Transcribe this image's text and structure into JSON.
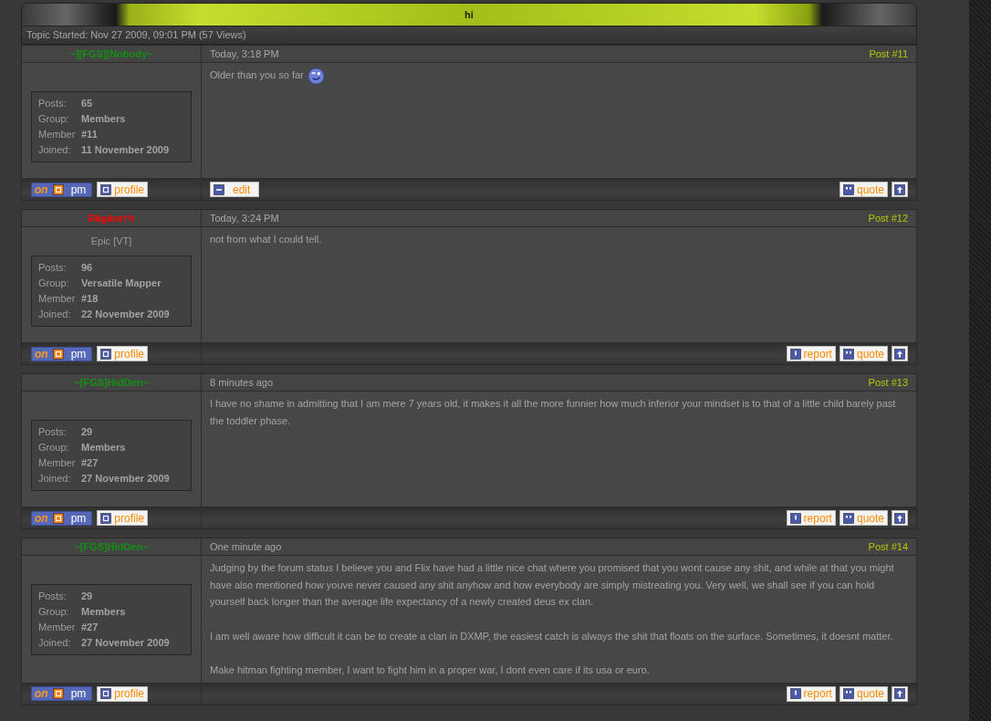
{
  "topic": {
    "title": "hi",
    "started": "Topic Started: Nov 27 2009, 09:01 PM (57 Views)"
  },
  "posts": [
    {
      "author": "~][FGS][Nobody~",
      "color": "#139013",
      "stats": [
        {
          "label": "Posts:",
          "value": "65"
        },
        {
          "label": "Group:",
          "value": "Members"
        },
        {
          "label": "Member",
          "value": "#11"
        },
        {
          "label": "Joined:",
          "value": "11 November 2009"
        }
      ],
      "time": "Today, 3:18 PM",
      "number": "Post #11",
      "paragraphs": [
        "Older than you so far"
      ],
      "smiley": true,
      "user_buttons": [
        {
          "kind": "pm",
          "status": "on",
          "label": "pm"
        },
        {
          "kind": "profile",
          "label": "profile"
        }
      ],
      "post_buttons_left": [
        {
          "kind": "edit",
          "label": "edit"
        }
      ],
      "post_buttons": [
        {
          "kind": "quote",
          "label": "quote"
        },
        {
          "kind": "top"
        }
      ]
    },
    {
      "author": "Ðägärø†h",
      "color": "#ff0000",
      "member_title": "Epic [VT]",
      "stats": [
        {
          "label": "Posts:",
          "value": "96"
        },
        {
          "label": "Group:",
          "value": "Versatile Mapper"
        },
        {
          "label": "Member",
          "value": "#18"
        },
        {
          "label": "Joined:",
          "value": "22 November 2009"
        }
      ],
      "time": "Today, 3:24 PM",
      "number": "Post #12",
      "paragraphs": [
        "not from what I could tell."
      ],
      "smiley": false,
      "user_buttons": [
        {
          "kind": "pm",
          "status": "on",
          "label": "pm"
        },
        {
          "kind": "profile",
          "label": "profile"
        }
      ],
      "post_buttons": [
        {
          "kind": "report",
          "label": "report"
        },
        {
          "kind": "quote",
          "label": "quote"
        },
        {
          "kind": "top"
        }
      ]
    },
    {
      "author": "~[FGS]HidDen~",
      "color": "#139013",
      "stats": [
        {
          "label": "Posts:",
          "value": "29"
        },
        {
          "label": "Group:",
          "value": "Members"
        },
        {
          "label": "Member",
          "value": "#27"
        },
        {
          "label": "Joined:",
          "value": "27 November 2009"
        }
      ],
      "time": "8 minutes ago",
      "number": "Post #13",
      "paragraphs": [
        "I have no shame in admitting that I am mere 7 years old, it makes it all the more funnier how much inferior your mindset is to that of a little child barely past the toddler phase."
      ],
      "smiley": false,
      "user_buttons": [
        {
          "kind": "pm",
          "status": "on",
          "label": "pm"
        },
        {
          "kind": "profile",
          "label": "profile"
        }
      ],
      "post_buttons": [
        {
          "kind": "report",
          "label": "report"
        },
        {
          "kind": "quote",
          "label": "quote"
        },
        {
          "kind": "top"
        }
      ]
    },
    {
      "author": "~[FGS]HidDen~",
      "color": "#139013",
      "stats": [
        {
          "label": "Posts:",
          "value": "29"
        },
        {
          "label": "Group:",
          "value": "Members"
        },
        {
          "label": "Member",
          "value": "#27"
        },
        {
          "label": "Joined:",
          "value": "27 November 2009"
        }
      ],
      "time": "One minute ago",
      "number": "Post #14",
      "paragraphs": [
        "Judging by the forum status I believe you and Flix have had a little nice chat where you promised that you wont cause any shit, and while at that you might have also mentioned how youve never caused any shit anyhow and how everybody are simply mistreating you. Very well, we shall see if you can hold yourself back longer than the average life expectancy of a newly created deus ex clan.",
        "I am well aware how difficult it can be to create a clan in DXMP, the easiest catch is always the shit that floats on the surface. Sometimes, it doesnt matter.",
        "Make hitman fighting member, I want to fight him in a proper war, I dont even care if its usa or euro."
      ],
      "smiley": false,
      "user_buttons": [
        {
          "kind": "pm",
          "status": "on",
          "label": "pm"
        },
        {
          "kind": "profile",
          "label": "profile"
        }
      ],
      "post_buttons": [
        {
          "kind": "report",
          "label": "report"
        },
        {
          "kind": "quote",
          "label": "quote"
        },
        {
          "kind": "top"
        }
      ]
    }
  ]
}
